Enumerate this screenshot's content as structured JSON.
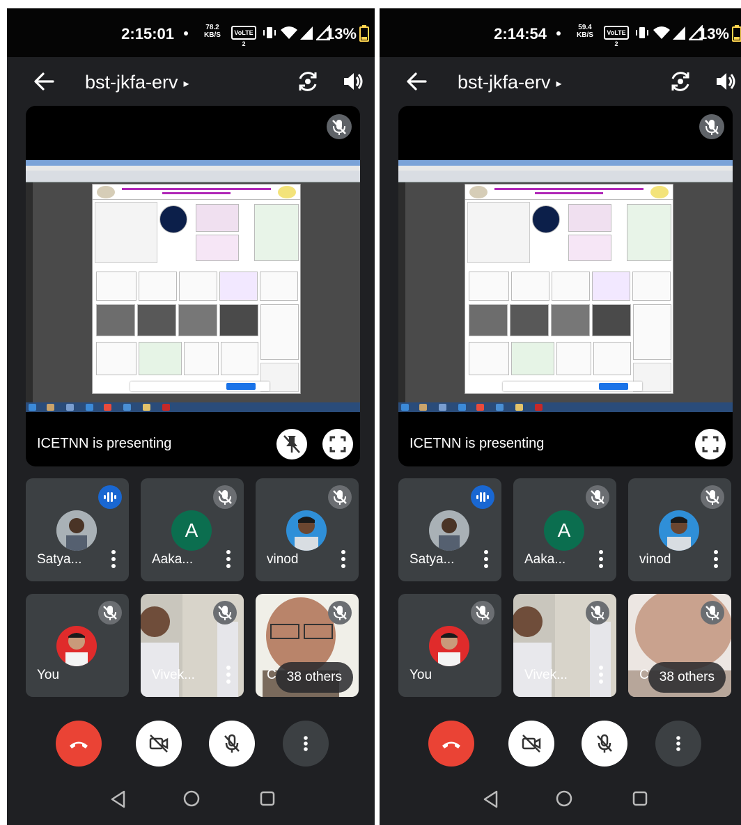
{
  "phones": [
    {
      "status_bar": {
        "time": "2:15:01",
        "net_speed_value": "78.2",
        "net_speed_unit": "KB/S",
        "volte_label": "VoLTE 2",
        "battery": "13%"
      },
      "app_bar": {
        "meeting_code": "bst-jkfa-erv",
        "caret": "▸"
      },
      "presentation": {
        "label": "ICETNN is presenting",
        "show_pin_button": true
      },
      "participants": [
        {
          "name": "Satya...",
          "state": "speaking"
        },
        {
          "name": "Aaka...",
          "initial": "A",
          "state": "muted"
        },
        {
          "name": "vinod",
          "state": "muted"
        },
        {
          "name": "You",
          "state": "muted"
        },
        {
          "name": "Vivek...",
          "state": "muted"
        },
        {
          "name": "C",
          "state": "muted",
          "others_label": "38 others"
        }
      ],
      "controls": [
        "end-call",
        "camera-off",
        "mic-off",
        "more"
      ]
    },
    {
      "status_bar": {
        "time": "2:14:54",
        "net_speed_value": "59.4",
        "net_speed_unit": "KB/S",
        "volte_label": "VoLTE 2",
        "battery": "13%"
      },
      "app_bar": {
        "meeting_code": "bst-jkfa-erv",
        "caret": "▸"
      },
      "presentation": {
        "label": "ICETNN is presenting",
        "show_pin_button": false
      },
      "participants": [
        {
          "name": "Satya...",
          "state": "speaking"
        },
        {
          "name": "Aaka...",
          "initial": "A",
          "state": "muted"
        },
        {
          "name": "vinod",
          "state": "muted"
        },
        {
          "name": "You",
          "state": "muted"
        },
        {
          "name": "Vivek...",
          "state": "muted"
        },
        {
          "name": "C",
          "state": "muted",
          "others_label": "38 others"
        }
      ],
      "controls": [
        "end-call",
        "camera-off",
        "mic-off",
        "more"
      ]
    }
  ],
  "colors": {
    "end_call": "#ea4335",
    "speaking_badge": "#1967d2",
    "tile_bg": "#3c4043",
    "screen_bg": "#1f2023"
  },
  "icons": [
    "back-arrow-icon",
    "caret-right-icon",
    "camera-rotate-icon",
    "speaker-icon",
    "mic-off-icon",
    "pin-off-icon",
    "fullscreen-icon",
    "audio-wave-icon",
    "more-vert-icon",
    "phone-hangup-icon",
    "video-off-icon",
    "nav-back-icon",
    "nav-home-icon",
    "nav-recents-icon"
  ]
}
